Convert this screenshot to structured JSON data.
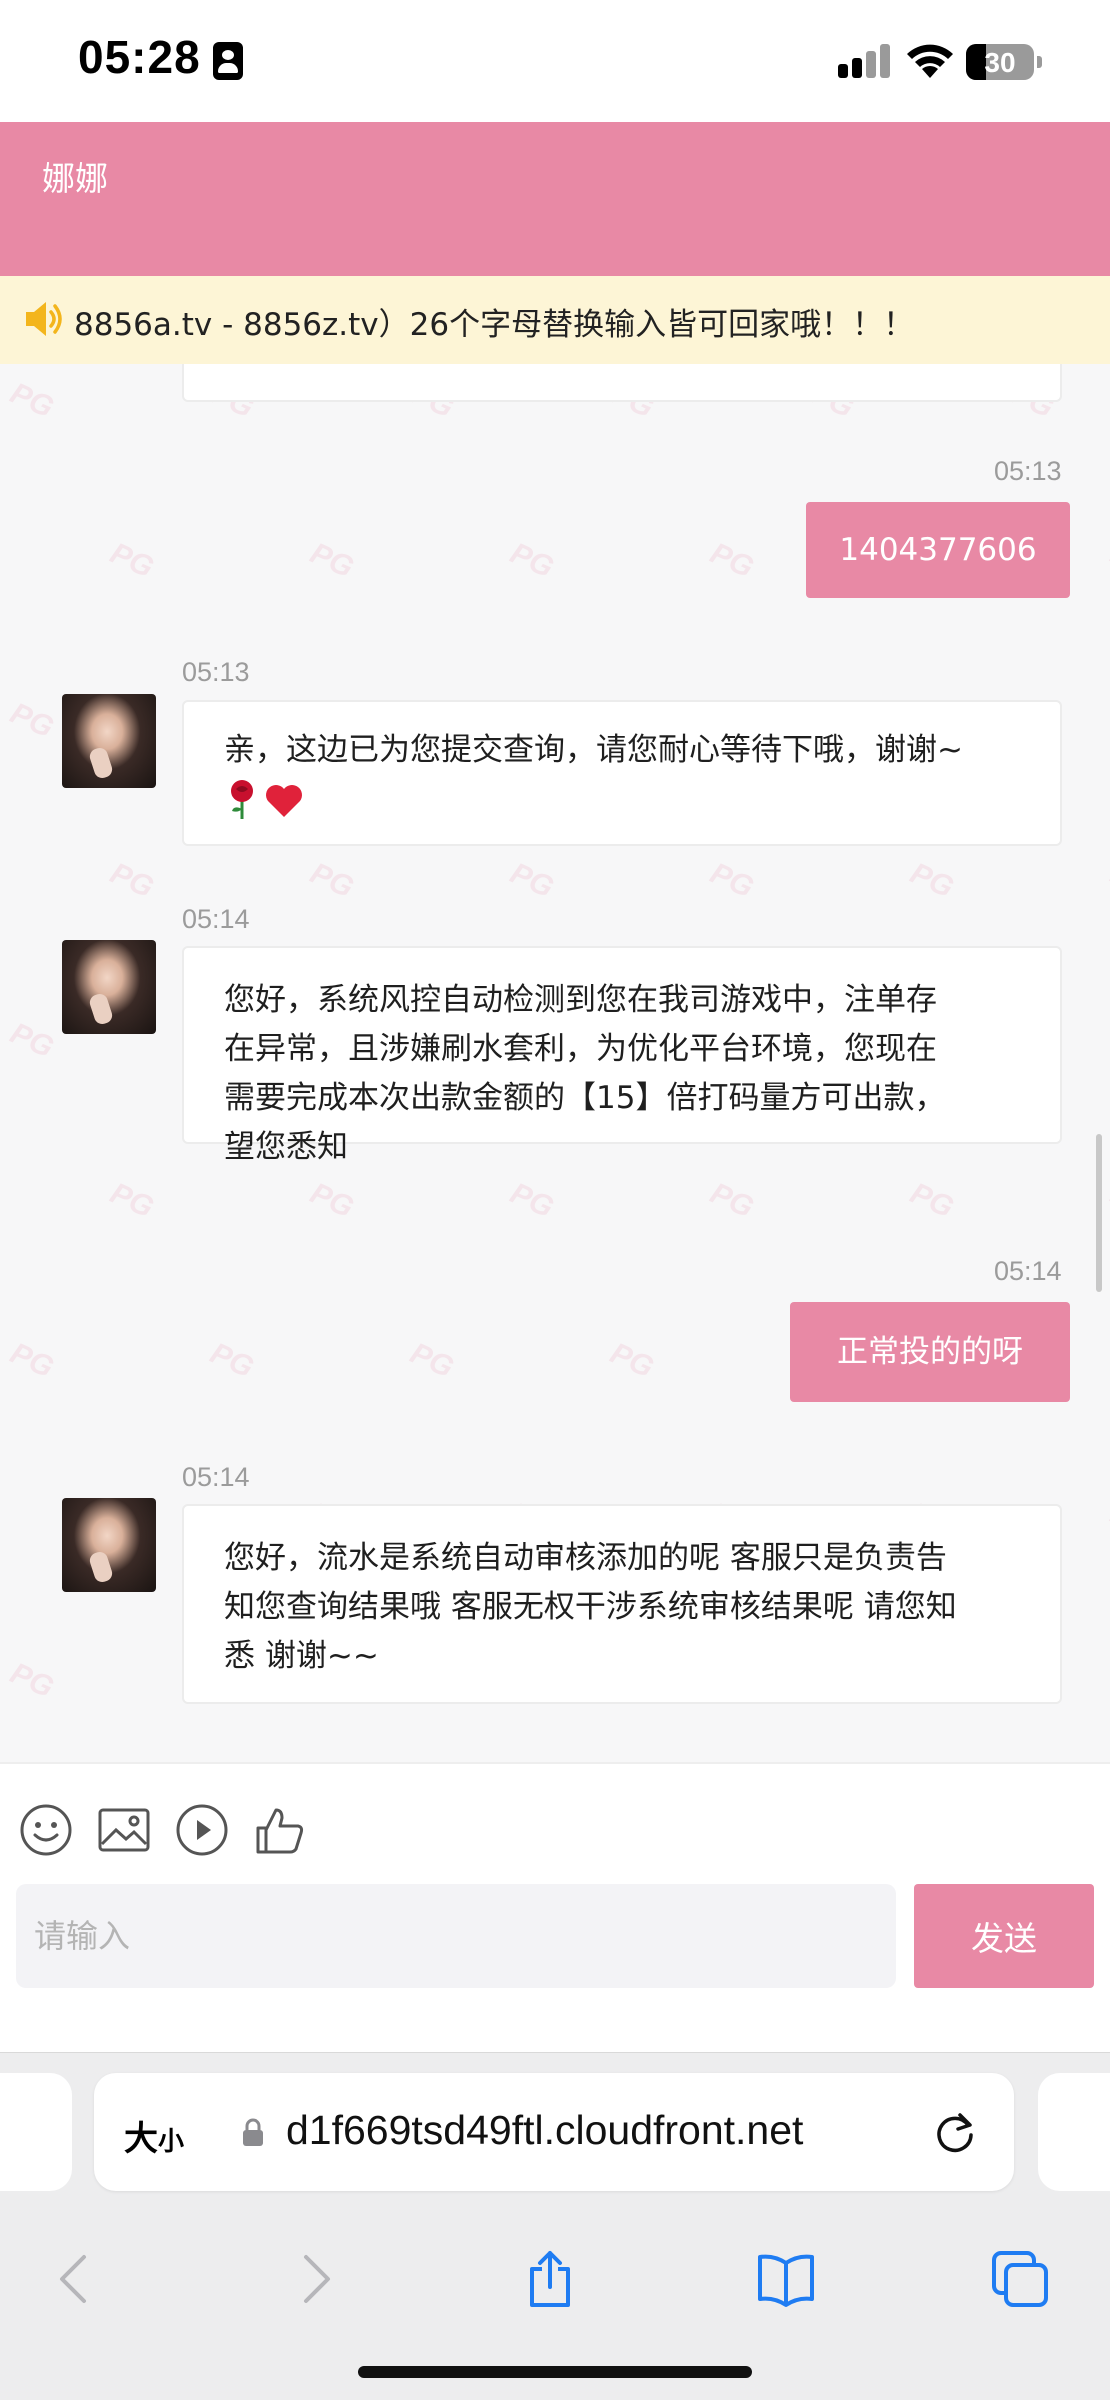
{
  "status_bar": {
    "time": "05:28",
    "battery": "30",
    "battery_level": 0.3,
    "icons": [
      "person-card-icon",
      "cellular-signal-icon",
      "wifi-icon",
      "battery-icon"
    ]
  },
  "header": {
    "title": "娜娜"
  },
  "notice": {
    "text": "8856a.tv - 8856z.tv）26个字母替换输入皆可回家哦！！！",
    "icon": "speaker-icon"
  },
  "messages": [
    {
      "type": "outgoing",
      "time": "05:13",
      "text": "1404377606"
    },
    {
      "type": "incoming",
      "time": "05:13",
      "text": "亲，这边已为您提交查询，请您耐心等待下哦，谢谢~",
      "emojis": [
        "rose-emoji",
        "heart-emoji"
      ]
    },
    {
      "type": "incoming",
      "time": "05:14",
      "lines": [
        "您好，系统风控自动检测到您在我司游戏中，注单存",
        "在异常，且涉嫌刷水套利，为优化平台环境，您现在",
        "需要完成本次出款金额的【15】倍打码量方可出款，",
        "望您悉知"
      ]
    },
    {
      "type": "outgoing",
      "time": "05:14",
      "text": "正常投的的呀"
    },
    {
      "type": "incoming",
      "time": "05:14",
      "lines": [
        "您好，流水是系统自动审核添加的呢 客服只是负责告",
        "知您查询结果哦 客服无权干涉系统审核结果呢 请您知",
        "悉 谢谢~~"
      ]
    }
  ],
  "composer": {
    "tools": [
      "emoji-icon",
      "image-icon",
      "video-icon",
      "thumbs-up-icon"
    ],
    "placeholder": "请输入",
    "value": "",
    "send_label": "发送"
  },
  "watermark": {
    "text": "PG"
  },
  "safari": {
    "text_size_label": "大",
    "text_size_small": "小",
    "url": "d1f669tsd49ftl.cloudfront.net",
    "nav_icons": [
      "back-icon",
      "forward-icon",
      "share-icon",
      "bookmarks-icon",
      "tabs-icon"
    ]
  },
  "colors": {
    "accent": "#e889a5",
    "notice_bg": "#fdf5d6",
    "background": "#f7f7f8"
  }
}
